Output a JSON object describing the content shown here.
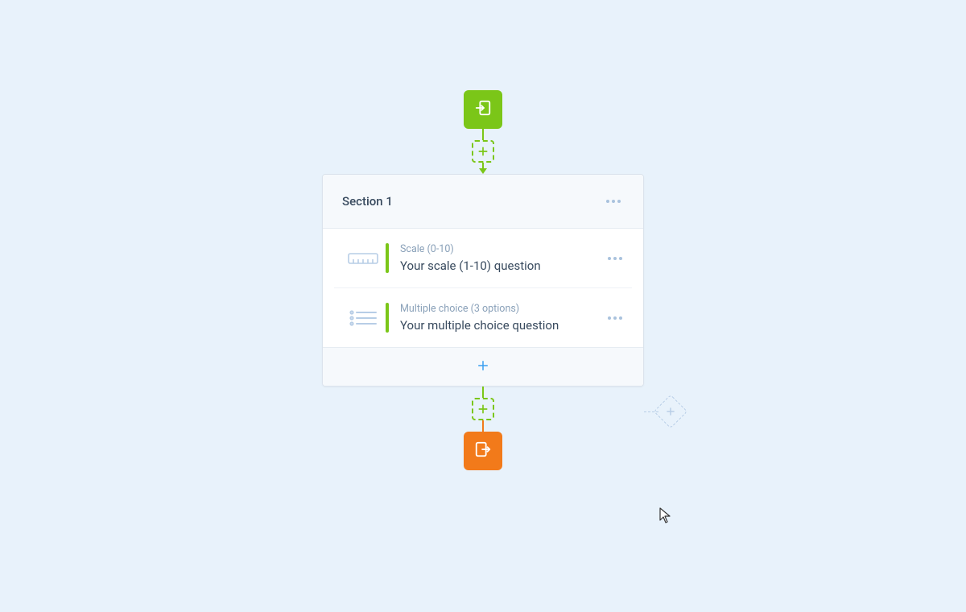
{
  "flow": {
    "section": {
      "title": "Section 1",
      "questions": [
        {
          "type_label": "Scale (0-10)",
          "text": "Your scale (1-10) question",
          "icon": "ruler"
        },
        {
          "type_label": "Multiple choice (3 options)",
          "text": "Your multiple choice question",
          "icon": "list"
        }
      ]
    }
  },
  "colors": {
    "start": "#7bc618",
    "end": "#f27a1a",
    "accent_blue": "#3a9ff0",
    "icon_muted": "#b7cde6"
  }
}
